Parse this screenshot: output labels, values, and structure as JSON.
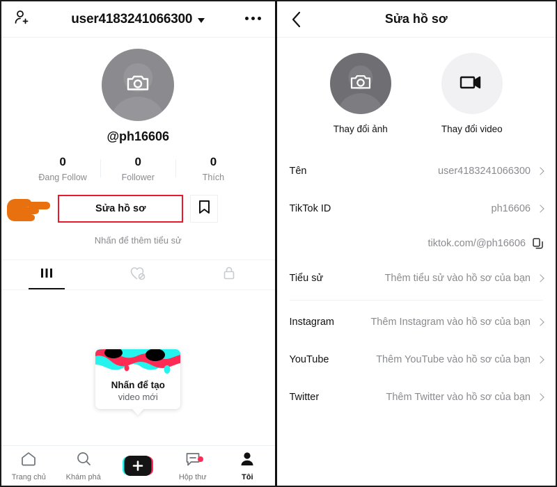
{
  "left_panel": {
    "header": {
      "add_user_icon": "add-user-icon",
      "title": "user4183241066300",
      "dropdown_icon": "chevron-down-icon",
      "more_icon": "more-options-icon"
    },
    "avatar": {
      "icon": "camera-icon",
      "placeholder_color": "#8b8b8f"
    },
    "handle": "@ph16606",
    "stats": [
      {
        "value": "0",
        "label": "Đang Follow"
      },
      {
        "value": "0",
        "label": "Follower"
      },
      {
        "value": "0",
        "label": "Thích"
      }
    ],
    "edit_profile_label": "Sửa hồ sơ",
    "edit_profile_highlight_color": "#e8192c",
    "bookmark_icon": "bookmark-icon",
    "cursor_icon": "pointing-hand-icon",
    "bio_hint": "Nhấn để thêm tiểu sử",
    "tabs": [
      {
        "icon": "grid-posts-icon",
        "active": true
      },
      {
        "icon": "heart-off-icon",
        "active": false
      },
      {
        "icon": "lock-icon",
        "active": false
      }
    ],
    "create_card": {
      "line1": "Nhấn để tạo",
      "line2": "video mới",
      "art_colors": [
        "#25f4ee",
        "#fe2c55",
        "#000000"
      ]
    },
    "bottom_nav": [
      {
        "icon": "home-icon",
        "label": "Trang chủ",
        "active": false,
        "badge": false
      },
      {
        "icon": "search-icon",
        "label": "Khám phá",
        "active": false,
        "badge": false
      },
      {
        "icon": "create-plus-icon",
        "label": "",
        "active": false,
        "badge": false
      },
      {
        "icon": "inbox-icon",
        "label": "Hộp thư",
        "active": false,
        "badge": true
      },
      {
        "icon": "profile-icon",
        "label": "Tôi",
        "active": true,
        "badge": false
      }
    ],
    "badge_color": "#fe2c55"
  },
  "right_panel": {
    "header": {
      "back_icon": "back-chevron-icon",
      "title": "Sửa hồ sơ"
    },
    "media": [
      {
        "icon": "camera-icon",
        "label": "Thay đổi ảnh",
        "circle_color": "#6e6e73"
      },
      {
        "icon": "video-camera-icon",
        "label": "Thay đổi video",
        "circle_color": "#f1f1f3"
      }
    ],
    "rows": [
      {
        "label": "Tên",
        "value": "user4183241066300",
        "accessory": "chevron-right-icon",
        "divider_after": false
      },
      {
        "label": "TikTok ID",
        "value": "ph16606",
        "accessory": "chevron-right-icon",
        "divider_after": false
      },
      {
        "label": "",
        "value": "tiktok.com/@ph16606",
        "accessory": "copy-icon",
        "divider_after": false
      },
      {
        "label": "Tiểu sử",
        "value": "Thêm tiểu sử vào hồ sơ của bạn",
        "accessory": "chevron-right-icon",
        "divider_after": true
      },
      {
        "label": "Instagram",
        "value": "Thêm Instagram vào hồ sơ của bạn",
        "accessory": "chevron-right-icon",
        "divider_after": false
      },
      {
        "label": "YouTube",
        "value": "Thêm YouTube vào hồ sơ của bạn",
        "accessory": "chevron-right-icon",
        "divider_after": false
      },
      {
        "label": "Twitter",
        "value": "Thêm Twitter vào hồ sơ của bạn",
        "accessory": "chevron-right-icon",
        "divider_after": false
      }
    ]
  }
}
